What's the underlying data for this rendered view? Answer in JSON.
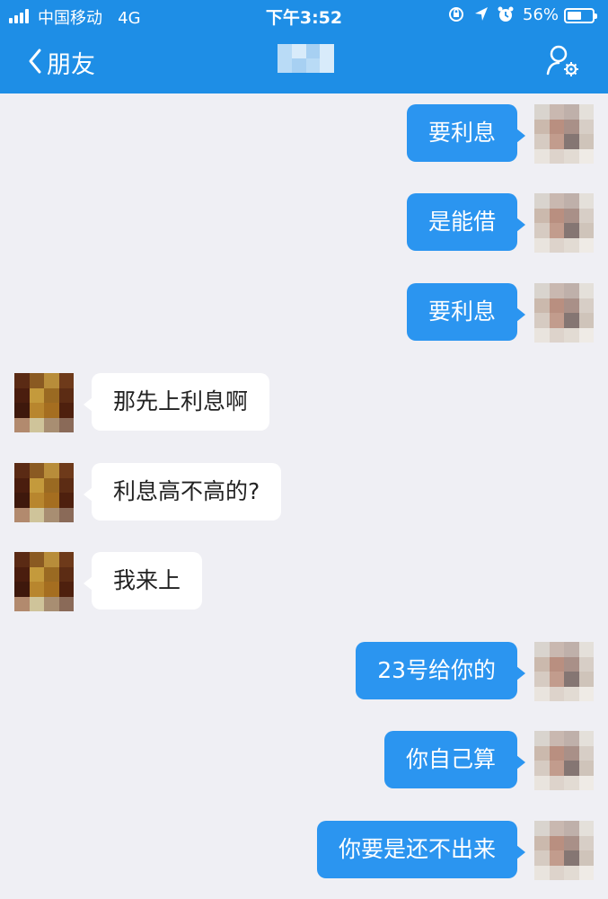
{
  "status_bar": {
    "carrier": "中国移动",
    "network": "4G",
    "time": "下午3:52",
    "battery_percent": "56%",
    "battery_level": 0.56
  },
  "nav": {
    "back_label": "朋友"
  },
  "messages": [
    {
      "from": "me",
      "text": "要利息"
    },
    {
      "from": "me",
      "text": "是能借"
    },
    {
      "from": "me",
      "text": "要利息"
    },
    {
      "from": "them",
      "text": "那先上利息啊"
    },
    {
      "from": "them",
      "text": "利息高不高的?"
    },
    {
      "from": "them",
      "text": "我来上"
    },
    {
      "from": "me",
      "text": "23号给你的"
    },
    {
      "from": "me",
      "text": "你自己算"
    },
    {
      "from": "me",
      "text": "你要是还不出来"
    }
  ],
  "colors": {
    "accent": "#1e8ee6",
    "outgoing_bubble": "#2b95f0",
    "incoming_bubble": "#ffffff",
    "chat_background": "#efeff4"
  },
  "icons": {
    "back": "chevron-left-icon",
    "profile": "user-settings-icon",
    "lock": "orientation-lock-icon",
    "location": "location-arrow-icon",
    "alarm": "alarm-icon"
  }
}
